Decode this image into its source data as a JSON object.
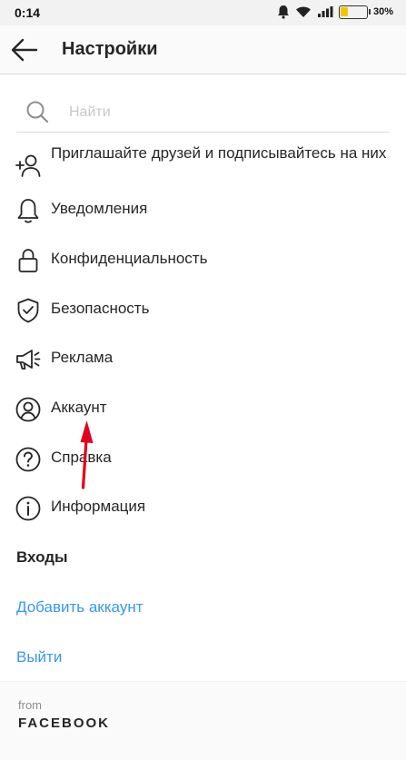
{
  "status_bar": {
    "time": "0:14",
    "battery_percent": "30%",
    "battery_level": 0.3,
    "battery_color": "#f5c400"
  },
  "header": {
    "title": "Настройки",
    "back_icon": "arrow-left-icon"
  },
  "search": {
    "placeholder": "Найти",
    "value": "",
    "icon": "search-icon"
  },
  "menu": [
    {
      "label": "Приглашайте друзей и подписывайтесь на них",
      "icon": "add-user-icon"
    },
    {
      "label": "Уведомления",
      "icon": "bell-icon"
    },
    {
      "label": "Конфиденциальность",
      "icon": "lock-icon"
    },
    {
      "label": "Безопасность",
      "icon": "shield-check-icon"
    },
    {
      "label": "Реклама",
      "icon": "megaphone-icon"
    },
    {
      "label": "Аккаунт",
      "icon": "account-icon"
    },
    {
      "label": "Справка",
      "icon": "help-icon"
    },
    {
      "label": "Информация",
      "icon": "info-icon"
    }
  ],
  "logins": {
    "title": "Входы",
    "add_account": "Добавить аккаунт",
    "logout": "Выйти",
    "link_color": "#3897f0"
  },
  "footer": {
    "from": "from",
    "brand": "FACEBOOK"
  },
  "annotation": {
    "type": "arrow",
    "color": "#e0001b",
    "points_to": "Аккаунт"
  }
}
